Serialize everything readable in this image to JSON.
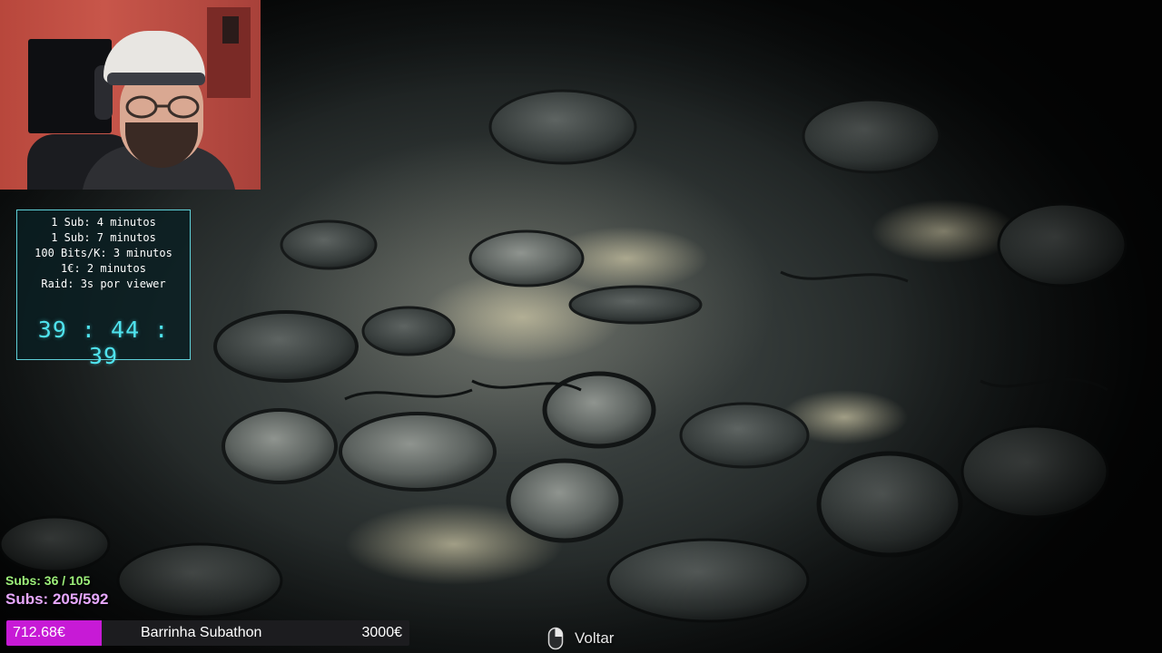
{
  "hud": {
    "timer": {
      "rules": [
        "1 Sub: 4 minutos",
        "1 Sub: 7 minutos",
        "100 Bits/K: 3 minutos",
        "1€: 2 minutos",
        "Raid: 3s por viewer"
      ],
      "countdown": "39 : 44 : 39",
      "accent_color": "#4fe3ee"
    },
    "subs_goal_small": "Subs: 36 / 105",
    "subs_goal_big": "Subs: 205/592",
    "subathon_bar": {
      "current": "712.68€",
      "label": "Barrinha Subathon",
      "goal": "3000€",
      "progress_fraction": 0.2376,
      "fill_color": "#c71ad6"
    }
  },
  "game": {
    "prompt_icon": "mouse-right-click-icon",
    "back_label": "Voltar"
  }
}
